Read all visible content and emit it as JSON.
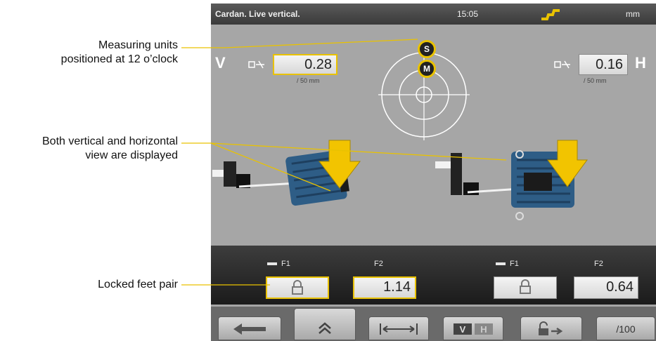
{
  "annotations": {
    "measuring_units_line1": "Measuring units",
    "measuring_units_line2": "positioned at 12 o’clock",
    "views_line1": "Both vertical and horizontal",
    "views_line2": "view are displayed",
    "locked_feet": "Locked feet pair"
  },
  "header": {
    "title": "Cardan. Live vertical.",
    "time": "15:05",
    "unit": "mm"
  },
  "vertical": {
    "label": "V",
    "value": "0.28",
    "per": "/ 50 mm"
  },
  "horizontal": {
    "label": "H",
    "value": "0.16",
    "per": "/ 50 mm"
  },
  "units_marker": {
    "stationary": "S",
    "movable": "M"
  },
  "feet": {
    "vertical": {
      "f1_label": "F1",
      "f2_label": "F2",
      "f2_value": "1.14"
    },
    "horizontal": {
      "f1_label": "F1",
      "f2_label": "F2",
      "f2_value": "0.64"
    }
  },
  "nav": {
    "resolution_label": "/100"
  },
  "colors": {
    "accent": "#e9c200",
    "motor": "#2e5d86",
    "arrow": "#f2c400",
    "screen_bg": "#a6a6a6"
  }
}
